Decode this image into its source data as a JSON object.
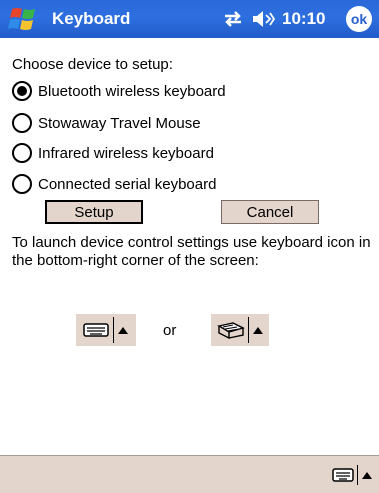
{
  "titlebar": {
    "app_title": "Keyboard",
    "time": "10:10",
    "ok_label": "ok",
    "start_icon": "windows-flag-icon",
    "connectivity_icon": "connectivity-icon",
    "volume_icon": "speaker-icon"
  },
  "setup": {
    "prompt": "Choose device to setup:",
    "options": [
      {
        "label": "Bluetooth wireless keyboard",
        "selected": true
      },
      {
        "label": "Stowaway Travel Mouse",
        "selected": false
      },
      {
        "label": "Infrared wireless keyboard",
        "selected": false
      },
      {
        "label": "Connected serial keyboard",
        "selected": false
      }
    ],
    "setup_label": "Setup",
    "cancel_label": "Cancel"
  },
  "instructions": {
    "text": "To launch device control settings use keyboard icon in the bottom-right corner of the screen:",
    "or_text": "or",
    "icon_left": "keyboard-icon",
    "icon_right": "keyboard-settings-icon"
  },
  "bottombar": {
    "input_icon": "keyboard-icon"
  },
  "colors": {
    "titlebar": "#2a68d8",
    "button_face": "#e3d4cc",
    "text": "#000000"
  }
}
